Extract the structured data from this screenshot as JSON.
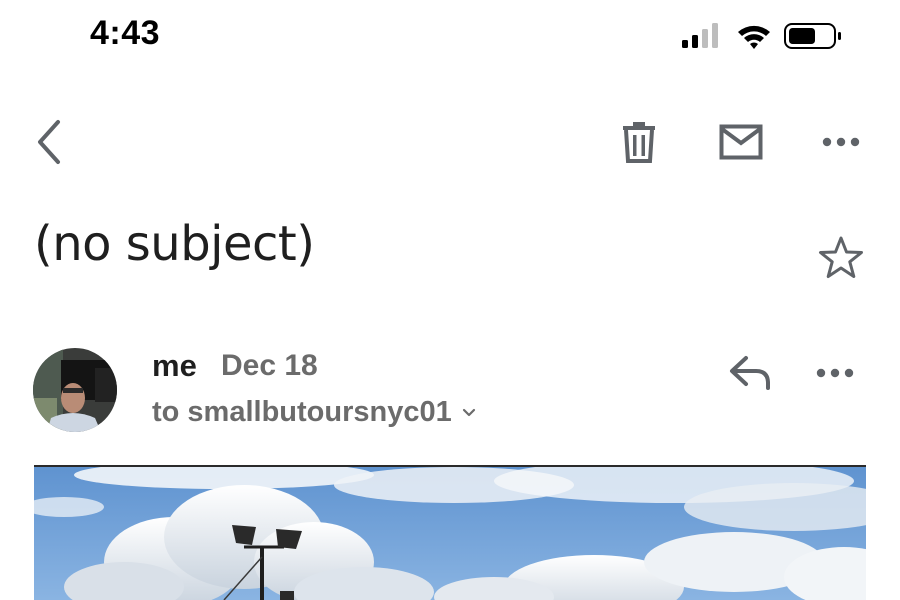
{
  "status_bar": {
    "time": "4:43",
    "icons": [
      "signal-icon",
      "wifi-icon",
      "battery-icon"
    ]
  },
  "toolbar": {
    "icons": [
      "back-chevron-icon",
      "trash-icon",
      "mail-icon",
      "more-icon"
    ]
  },
  "email": {
    "subject": "(no subject)",
    "sender": "me",
    "date": "Dec 18",
    "recipient": "to smallbutoursnyc01"
  },
  "colors": {
    "text_primary": "#1f1f1f",
    "text_secondary": "#6b6b6b",
    "icon": "#5f6368",
    "sky": "#6d9fd6"
  }
}
